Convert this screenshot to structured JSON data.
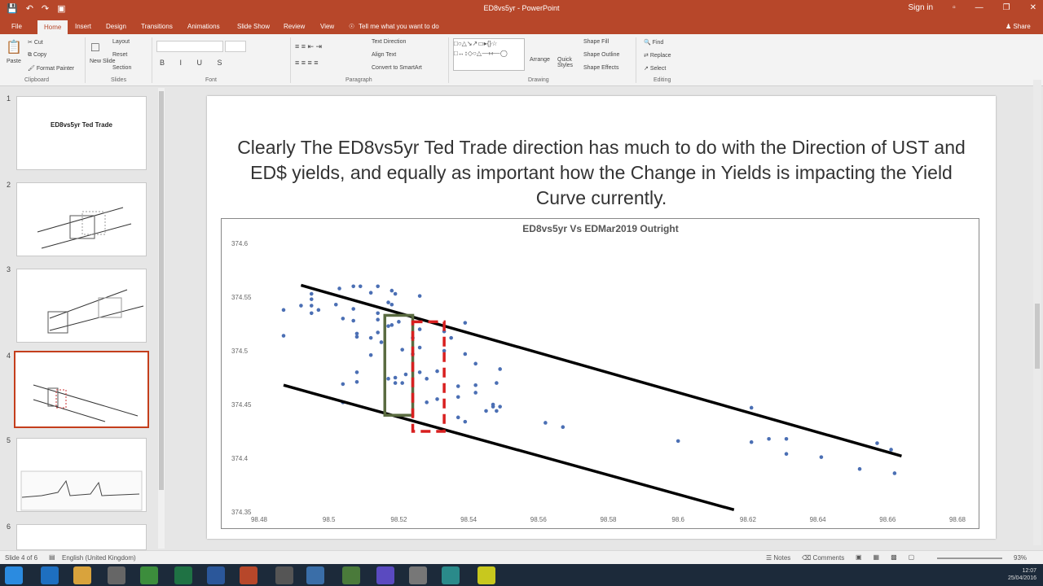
{
  "window": {
    "title": "ED8vs5yr - PowerPoint",
    "signin": "Sign in",
    "share": "Share",
    "tell_me": "Tell me what you want to do"
  },
  "tabs": [
    "File",
    "Home",
    "Insert",
    "Design",
    "Transitions",
    "Animations",
    "Slide Show",
    "Review",
    "View"
  ],
  "ribbon": {
    "clipboard": {
      "paste": "Paste",
      "cut": "Cut",
      "copy": "Copy",
      "format_painter": "Format Painter",
      "label": "Clipboard"
    },
    "slides": {
      "new_slide": "New Slide",
      "layout": "Layout",
      "reset": "Reset",
      "section": "Section",
      "label": "Slides"
    },
    "font_label": "Font",
    "paragraph": {
      "text_direction": "Text Direction",
      "align_text": "Align Text",
      "convert": "Convert to SmartArt",
      "label": "Paragraph"
    },
    "drawing": {
      "arrange": "Arrange",
      "quick_styles": "Quick Styles",
      "shape_fill": "Shape Fill",
      "shape_outline": "Shape Outline",
      "shape_effects": "Shape Effects",
      "label": "Drawing"
    },
    "editing": {
      "find": "Find",
      "replace": "Replace",
      "select": "Select",
      "label": "Editing"
    }
  },
  "thumbnails": [
    {
      "num": "1",
      "title": "ED8vs5yr Ted Trade"
    },
    {
      "num": "2",
      "title": ""
    },
    {
      "num": "3",
      "title": ""
    },
    {
      "num": "4",
      "title": ""
    },
    {
      "num": "5",
      "title": ""
    },
    {
      "num": "6",
      "title": ""
    }
  ],
  "slide": {
    "text": "Clearly The ED8vs5yr Ted Trade direction has much to do with the Direction of UST and ED$ yields, and equally as important how the Change in Yields is impacting the Yield Curve currently."
  },
  "chart_data": {
    "type": "scatter",
    "title": "ED8vs5yr Vs EDMar2019 Outright",
    "xlabel": "",
    "ylabel": "",
    "xlim": [
      98.48,
      98.68
    ],
    "ylim": [
      374.35,
      374.6
    ],
    "x_ticks": [
      "98.48",
      "98.5",
      "98.52",
      "98.54",
      "98.56",
      "98.58",
      "98.6",
      "98.62",
      "98.64",
      "98.66",
      "98.68"
    ],
    "y_ticks": [
      "374.6",
      "374.55",
      "374.5",
      "374.45",
      "374.4",
      "374.35"
    ],
    "grid": false,
    "points": [
      [
        98.487,
        374.538
      ],
      [
        98.487,
        374.514
      ],
      [
        98.492,
        374.542
      ],
      [
        98.495,
        374.542
      ],
      [
        98.495,
        374.548
      ],
      [
        98.495,
        374.553
      ],
      [
        98.495,
        374.535
      ],
      [
        98.497,
        374.538
      ],
      [
        98.502,
        374.543
      ],
      [
        98.503,
        374.558
      ],
      [
        98.504,
        374.53
      ],
      [
        98.504,
        374.469
      ],
      [
        98.504,
        374.452
      ],
      [
        98.507,
        374.56
      ],
      [
        98.507,
        374.539
      ],
      [
        98.507,
        374.528
      ],
      [
        98.508,
        374.516
      ],
      [
        98.508,
        374.513
      ],
      [
        98.508,
        374.48
      ],
      [
        98.508,
        374.471
      ],
      [
        98.509,
        374.56
      ],
      [
        98.512,
        374.554
      ],
      [
        98.512,
        374.512
      ],
      [
        98.512,
        374.496
      ],
      [
        98.514,
        374.56
      ],
      [
        98.514,
        374.535
      ],
      [
        98.514,
        374.529
      ],
      [
        98.514,
        374.517
      ],
      [
        98.515,
        374.508
      ],
      [
        98.517,
        374.545
      ],
      [
        98.517,
        374.523
      ],
      [
        98.517,
        374.474
      ],
      [
        98.518,
        374.556
      ],
      [
        98.518,
        374.543
      ],
      [
        98.518,
        374.524
      ],
      [
        98.519,
        374.553
      ],
      [
        98.519,
        374.475
      ],
      [
        98.519,
        374.47
      ],
      [
        98.52,
        374.527
      ],
      [
        98.521,
        374.501
      ],
      [
        98.521,
        374.47
      ],
      [
        98.522,
        374.478
      ],
      [
        98.524,
        374.512
      ],
      [
        98.524,
        374.497
      ],
      [
        98.526,
        374.551
      ],
      [
        98.526,
        374.52
      ],
      [
        98.526,
        374.503
      ],
      [
        98.526,
        374.48
      ],
      [
        98.528,
        374.474
      ],
      [
        98.528,
        374.452
      ],
      [
        98.531,
        374.481
      ],
      [
        98.531,
        374.455
      ],
      [
        98.533,
        374.518
      ],
      [
        98.533,
        374.5
      ],
      [
        98.535,
        374.512
      ],
      [
        98.537,
        374.467
      ],
      [
        98.537,
        374.457
      ],
      [
        98.537,
        374.438
      ],
      [
        98.539,
        374.526
      ],
      [
        98.539,
        374.497
      ],
      [
        98.539,
        374.434
      ],
      [
        98.542,
        374.488
      ],
      [
        98.542,
        374.468
      ],
      [
        98.542,
        374.461
      ],
      [
        98.545,
        374.444
      ],
      [
        98.547,
        374.45
      ],
      [
        98.547,
        374.448
      ],
      [
        98.548,
        374.47
      ],
      [
        98.548,
        374.444
      ],
      [
        98.549,
        374.483
      ],
      [
        98.549,
        374.448
      ],
      [
        98.562,
        374.433
      ],
      [
        98.567,
        374.429
      ],
      [
        98.6,
        374.416
      ],
      [
        98.621,
        374.415
      ],
      [
        98.621,
        374.447
      ],
      [
        98.626,
        374.418
      ],
      [
        98.631,
        374.418
      ],
      [
        98.631,
        374.404
      ],
      [
        98.641,
        374.401
      ],
      [
        98.652,
        374.39
      ],
      [
        98.657,
        374.414
      ],
      [
        98.661,
        374.408
      ],
      [
        98.662,
        374.386
      ]
    ],
    "annotations": [
      {
        "type": "line",
        "from": [
          98.492,
          374.561
        ],
        "to": [
          98.664,
          374.402
        ]
      },
      {
        "type": "line",
        "from": [
          98.487,
          374.468
        ],
        "to": [
          98.616,
          374.352
        ]
      },
      {
        "type": "box",
        "color": "#5a6b40",
        "x": [
          98.516,
          98.524
        ],
        "y": [
          374.44,
          374.533
        ]
      },
      {
        "type": "dashed-box",
        "color": "#d81f1f",
        "x": [
          98.524,
          98.533
        ],
        "y": [
          374.425,
          374.527
        ]
      }
    ]
  },
  "status": {
    "slide_info": "Slide 4 of 6",
    "language": "English (United Kingdom)",
    "notes": "Notes",
    "comments": "Comments",
    "zoom": "93%"
  },
  "taskbar": {
    "time": "12:07",
    "date": "25/04/2016",
    "tray_text": "Phone Networks..."
  },
  "colors": {
    "ppt_accent": "#b7472a",
    "marker": "#4b6fb4",
    "green_box": "#5a6b40",
    "red_box": "#d81f1f"
  }
}
